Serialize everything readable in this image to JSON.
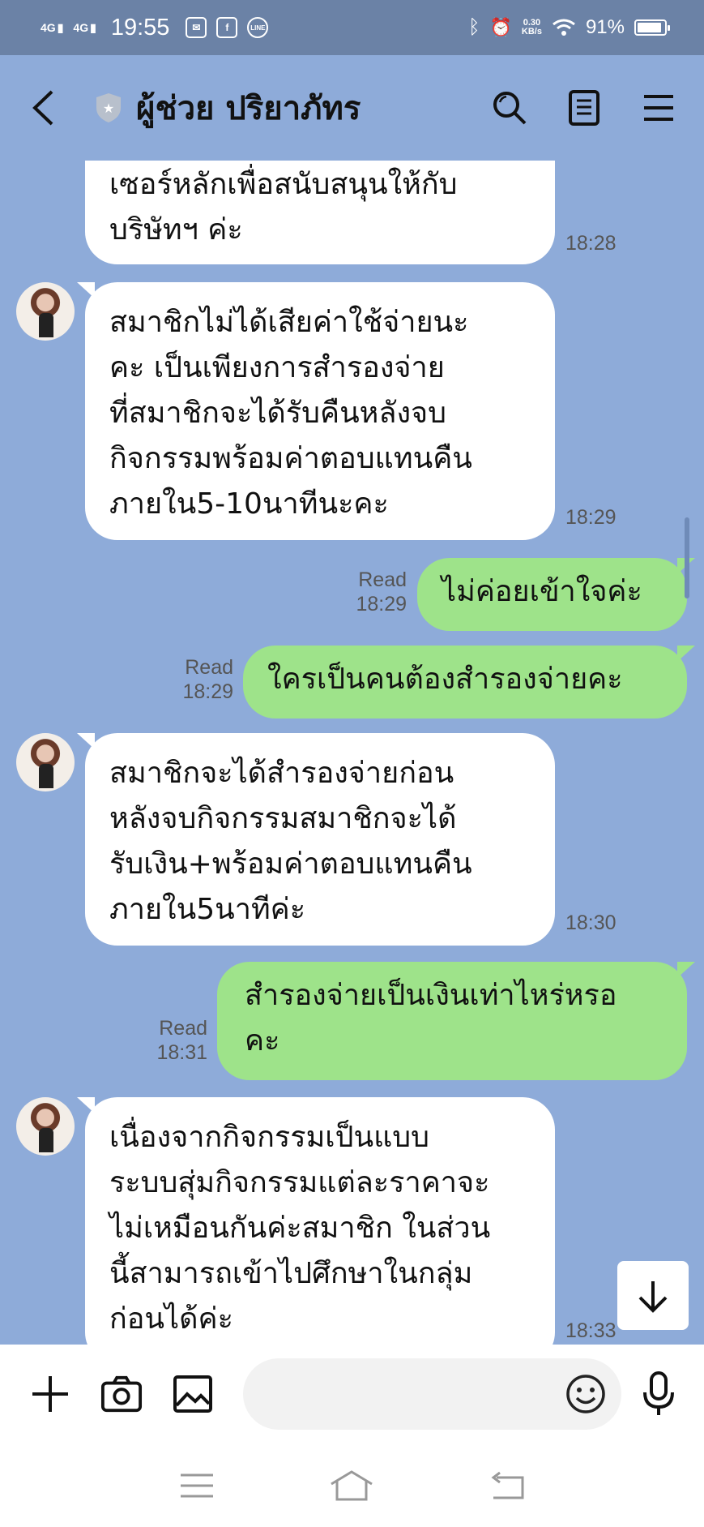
{
  "status_bar": {
    "network1": "4G",
    "network2": "4G",
    "time": "19:55",
    "speed_value": "0.30",
    "speed_unit": "KB/s",
    "battery_text": "91%",
    "battery_level": 0.91
  },
  "header": {
    "title": "ผู้ช่วย ปริยาภัทร"
  },
  "messages": [
    {
      "dir": "in",
      "text": "เซอร์หลักเพื่อสนับสนุนให้กับ\nบริษัทฯ ค่ะ",
      "time": "18:28"
    },
    {
      "dir": "in",
      "text": "สมาชิกไม่ได้เสียค่าใช้จ่ายนะ\nคะ เป็นเพียงการสำรองจ่าย\nที่สมาชิกจะได้รับคืนหลังจบ\nกิจกรรมพร้อมค่าตอบแทนคืน\nภายใน5-10นาทีนะคะ",
      "time": "18:29"
    },
    {
      "dir": "out",
      "text": "ไม่ค่อยเข้าใจค่ะ",
      "read": "Read",
      "time": "18:29"
    },
    {
      "dir": "out",
      "text": "ใครเป็นคนต้องสำรองจ่ายคะ",
      "read": "Read",
      "time": "18:29"
    },
    {
      "dir": "in",
      "text": "สมาชิกจะได้สำรองจ่ายก่อน\nหลังจบกิจกรรมสมาชิกจะได้\nรับเงิน+พร้อมค่าตอบแทนคืน\nภายใน5นาทีค่ะ",
      "time": "18:30"
    },
    {
      "dir": "out",
      "text": "สำรองจ่ายเป็นเงินเท่าไหร่หรอ\nคะ",
      "read": "Read",
      "time": "18:31"
    },
    {
      "dir": "in",
      "text": "เนื่องจากกิจกรรมเป็นแบบ\nระบบสุ่มกิจกรรมแต่ละราคาจะ\nไม่เหมือนกันค่ะสมาชิก ในส่วน\nนี้สามารถเข้าไปศึกษาในกลุ่ม\nก่อนได้ค่ะ",
      "time": "18:33"
    }
  ],
  "input": {
    "placeholder": ""
  }
}
